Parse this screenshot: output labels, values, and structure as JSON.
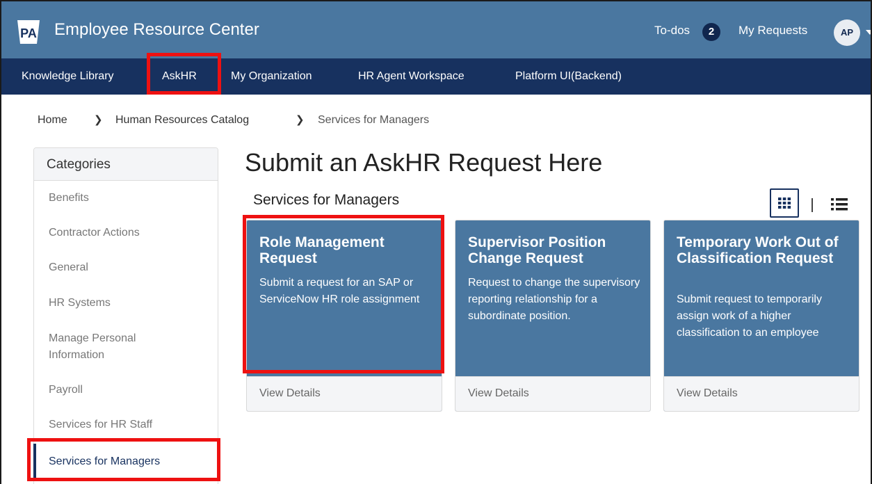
{
  "header": {
    "logo_text": "PA",
    "app_title": "Employee Resource Center",
    "todos_label": "To-dos",
    "todos_count": "2",
    "my_requests_label": "My Requests",
    "avatar_initials": "AP"
  },
  "nav": {
    "items": [
      {
        "label": "Knowledge Library"
      },
      {
        "label": "AskHR"
      },
      {
        "label": "My Organization"
      },
      {
        "label": "HR Agent Workspace"
      },
      {
        "label": "Platform UI(Backend)"
      }
    ]
  },
  "breadcrumb": {
    "items": [
      {
        "label": "Home"
      },
      {
        "label": "Human Resources Catalog"
      },
      {
        "label": "Services for Managers"
      }
    ]
  },
  "sidebar": {
    "heading": "Categories",
    "items": [
      {
        "label": "Benefits"
      },
      {
        "label": "Contractor Actions"
      },
      {
        "label": "General"
      },
      {
        "label": "HR Systems"
      },
      {
        "label": "Manage Personal Information"
      },
      {
        "label": "Payroll"
      },
      {
        "label": "Services for HR Staff"
      },
      {
        "label": "Services for Managers",
        "active": true
      }
    ]
  },
  "main": {
    "page_title": "Submit an AskHR Request Here",
    "section_title": "Services for Managers",
    "view_modes": [
      "grid-view-icon",
      "list-view-icon"
    ],
    "cards": [
      {
        "title": "Role Management Request",
        "description": "Submit a request for an SAP or ServiceNow HR role assignment",
        "action_label": "View Details"
      },
      {
        "title": "Supervisor Position Change Request",
        "description": "Request to change the supervisory reporting relationship for a subordinate position.",
        "action_label": "View Details"
      },
      {
        "title": "Temporary Work Out of Classification Request",
        "description": "Submit request to temporarily assign work of a higher classification to an employee",
        "action_label": "View Details"
      }
    ]
  },
  "colors": {
    "header_bg": "#4a77a0",
    "nav_bg": "#17315f",
    "card_bg": "#4a77a0",
    "highlight": "#ee1111"
  }
}
